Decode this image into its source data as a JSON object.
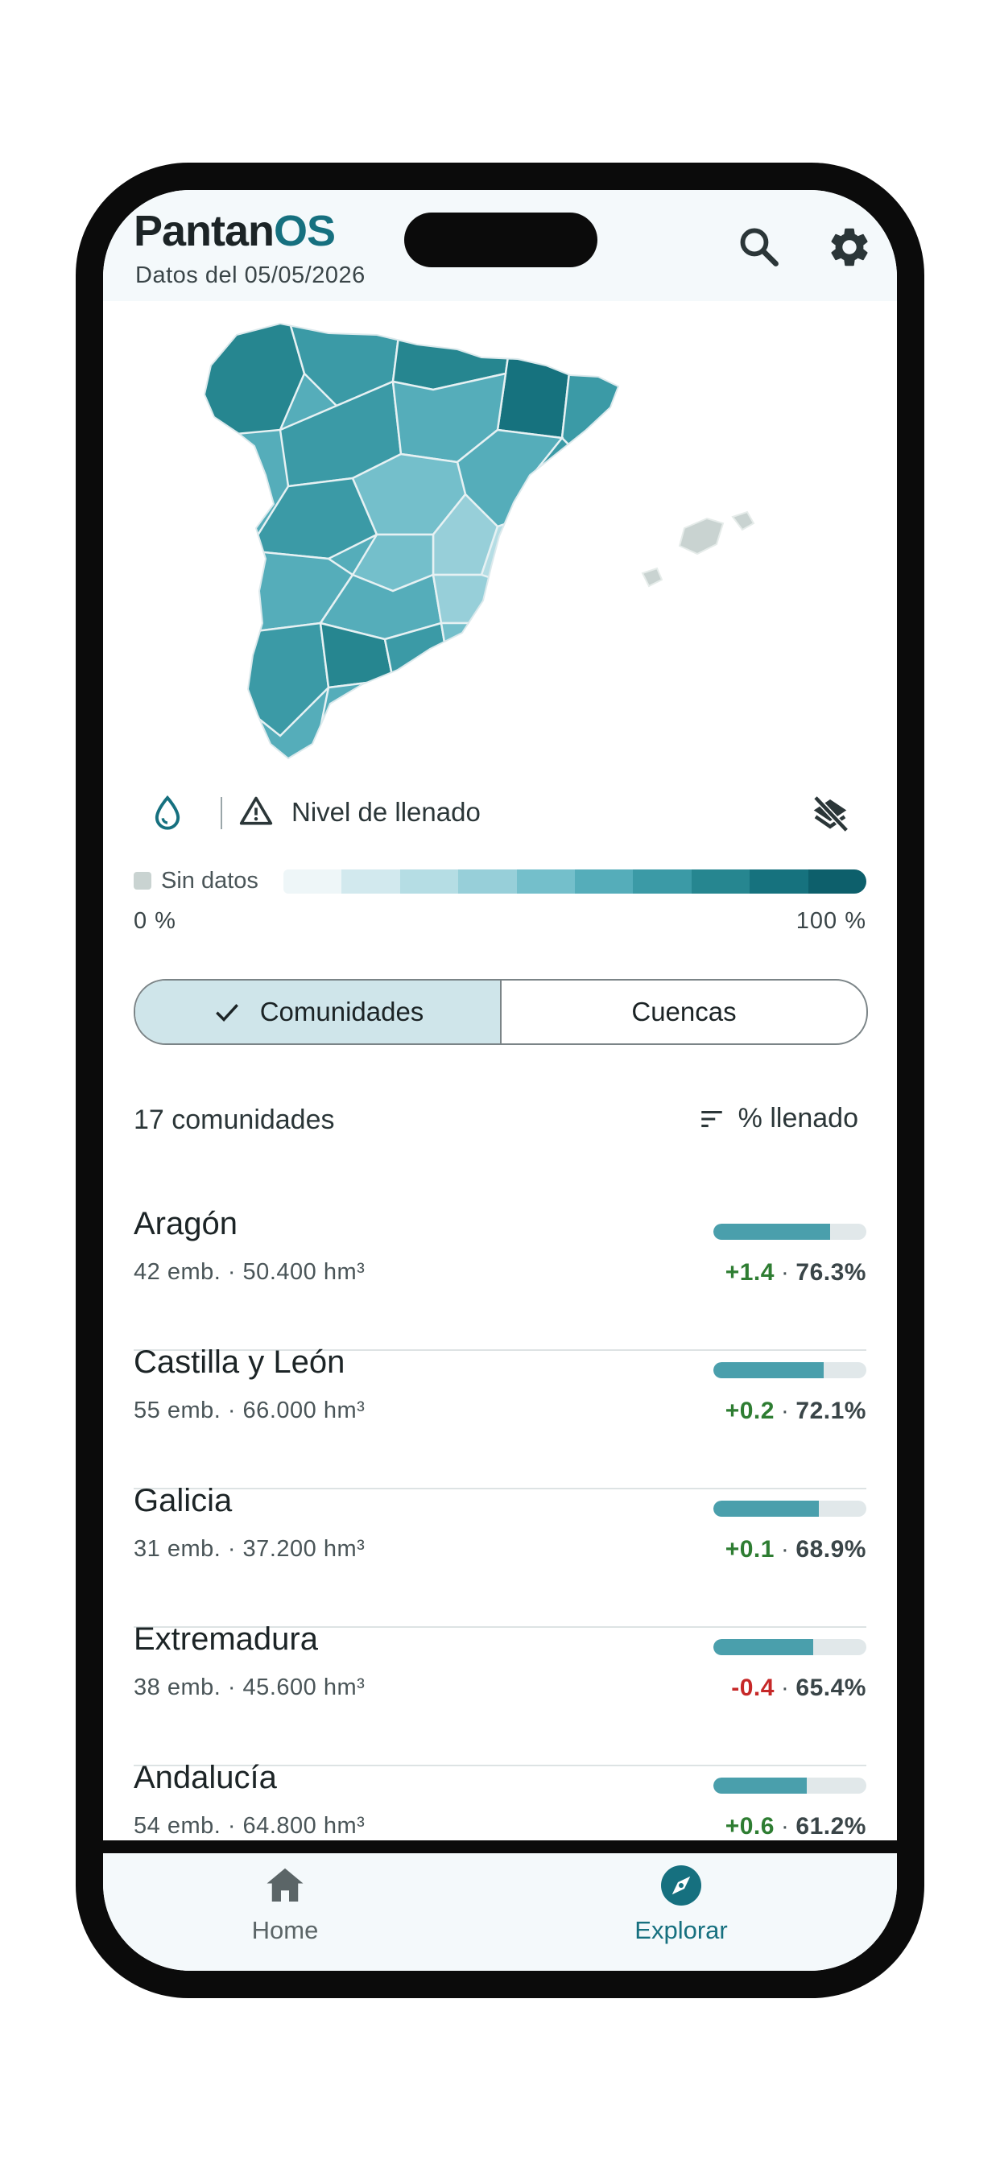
{
  "header": {
    "brand_part1": "Pantan",
    "brand_part2": "OS",
    "date": "Datos del 05/05/2026"
  },
  "icons": {
    "search": "search-icon",
    "settings": "gear-icon",
    "drop": "water-drop-icon",
    "warning": "warning-icon",
    "layers": "layers-off-icon",
    "check": "check-icon",
    "sort": "sort-icon",
    "home": "home-icon",
    "explore": "compass-icon"
  },
  "legend": {
    "title": "Nivel de llenado",
    "no_data": "Sin datos",
    "min_label": "0 %",
    "max_label": "100 %",
    "scale_colors": [
      "#eef6f8",
      "#d2e9ee",
      "#b5dde4",
      "#97cfd9",
      "#74bfcb",
      "#55adba",
      "#3b9aa6",
      "#268690",
      "#16727e",
      "#0d5f6b"
    ],
    "no_data_color": "#c9d3d1"
  },
  "segmented": {
    "option_1": "Comunidades",
    "option_2": "Cuencas",
    "selected": "Comunidades"
  },
  "list_header": {
    "count": "17 comunidades",
    "sort_label": "% llenado"
  },
  "items": [
    {
      "name": "Aragón",
      "meta": "42 emb. · 50.400 hm³",
      "delta": "+1.4",
      "trend": "pos",
      "sep": "·",
      "pct": "76.3%",
      "fill": 0.763
    },
    {
      "name": "Castilla y León",
      "meta": "55 emb. · 66.000 hm³",
      "delta": "+0.2",
      "trend": "pos",
      "sep": "·",
      "pct": "72.1%",
      "fill": 0.721
    },
    {
      "name": "Galicia",
      "meta": "31 emb. · 37.200 hm³",
      "delta": "+0.1",
      "trend": "pos",
      "sep": "·",
      "pct": "68.9%",
      "fill": 0.689
    },
    {
      "name": "Extremadura",
      "meta": "38 emb. · 45.600 hm³",
      "delta": "-0.4",
      "trend": "neg",
      "sep": "·",
      "pct": "65.4%",
      "fill": 0.654
    },
    {
      "name": "Andalucía",
      "meta": "54 emb. · 64.800 hm³",
      "delta": "+0.6",
      "trend": "pos",
      "sep": "·",
      "pct": "61.2%",
      "fill": 0.612
    }
  ],
  "nav": {
    "home": "Home",
    "explore": "Explorar",
    "active": "explore"
  },
  "colors": {
    "accent": "#16707f",
    "positive": "#2e7d32",
    "negative": "#c62828"
  }
}
